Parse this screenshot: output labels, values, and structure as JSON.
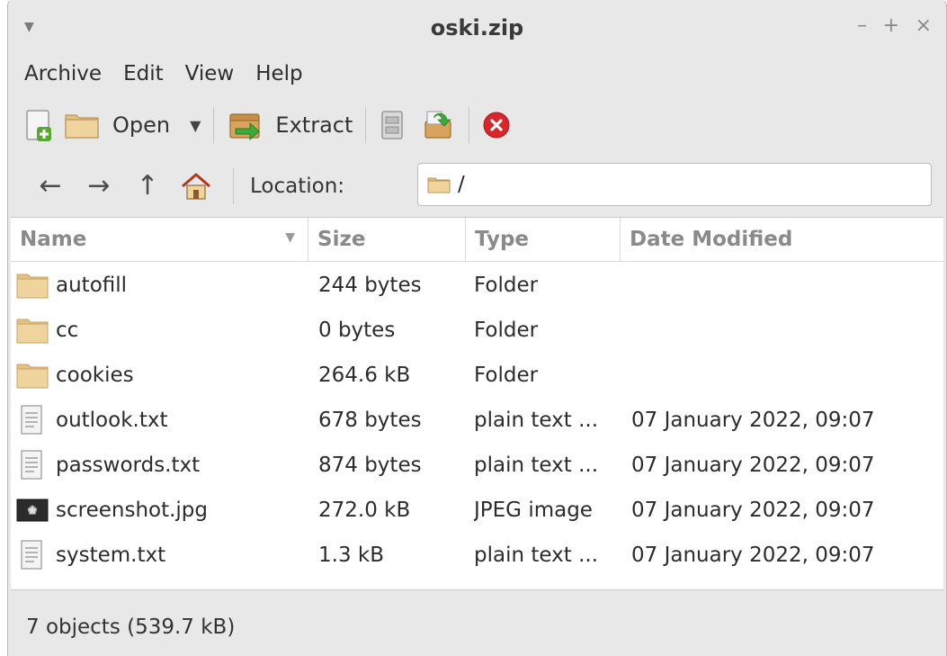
{
  "window": {
    "title": "oski.zip",
    "controls": {
      "minimize": "–",
      "maximize": "+",
      "close": "×"
    }
  },
  "menubar": {
    "items": [
      {
        "label": "Archive"
      },
      {
        "label": "Edit"
      },
      {
        "label": "View"
      },
      {
        "label": "Help"
      }
    ]
  },
  "toolbar": {
    "open_label": "Open",
    "extract_label": "Extract"
  },
  "locationbar": {
    "label": "Location:",
    "path": "/"
  },
  "list": {
    "columns": [
      "Name",
      "Size",
      "Type",
      "Date Modified"
    ],
    "rows": [
      {
        "name": "autofill",
        "size": "244 bytes",
        "type": "Folder",
        "modified": "",
        "icon": "folder-icon"
      },
      {
        "name": "cc",
        "size": "0 bytes",
        "type": "Folder",
        "modified": "",
        "icon": "folder-icon"
      },
      {
        "name": "cookies",
        "size": "264.6 kB",
        "type": "Folder",
        "modified": "",
        "icon": "folder-icon"
      },
      {
        "name": "outlook.txt",
        "size": "678 bytes",
        "type": "plain text ...",
        "modified": "07 January 2022, 09:07",
        "icon": "text-file-icon"
      },
      {
        "name": "passwords.txt",
        "size": "874 bytes",
        "type": "plain text ...",
        "modified": "07 January 2022, 09:07",
        "icon": "text-file-icon"
      },
      {
        "name": "screenshot.jpg",
        "size": "272.0 kB",
        "type": "JPEG image",
        "modified": "07 January 2022, 09:07",
        "icon": "image-file-icon"
      },
      {
        "name": "system.txt",
        "size": "1.3 kB",
        "type": "plain text ...",
        "modified": "07 January 2022, 09:07",
        "icon": "text-file-icon"
      }
    ]
  },
  "statusbar": {
    "text": "7 objects (539.7 kB)"
  },
  "colors": {
    "window_bg": "#e8e8e8",
    "list_bg": "#ffffff",
    "folder": "#e9c98b",
    "stop_red": "#d9262b"
  }
}
